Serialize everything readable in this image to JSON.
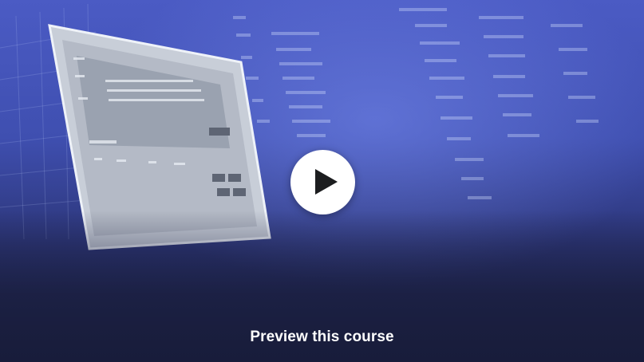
{
  "preview": {
    "label": "Preview this course",
    "play_icon": "play-icon"
  },
  "colors": {
    "background_top": "#4b5bc4",
    "background_bottom": "#1e2449",
    "play_button": "#ffffff",
    "play_icon": "#1c1d1f",
    "label": "#ffffff"
  }
}
